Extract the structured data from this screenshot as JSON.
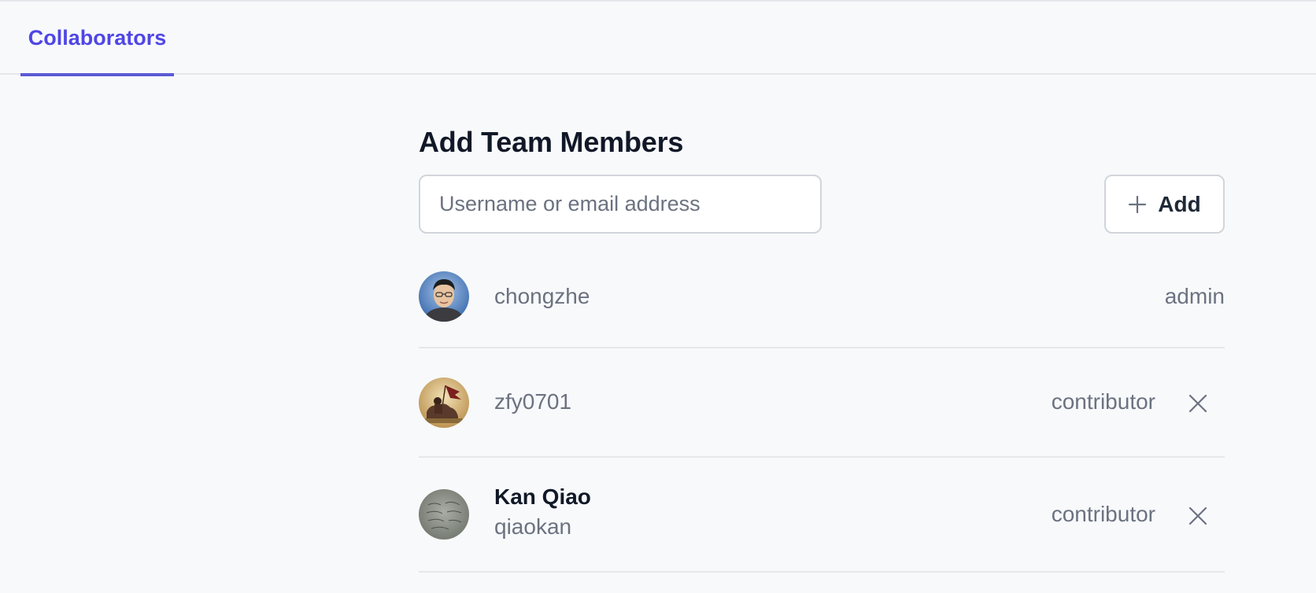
{
  "tabs": [
    {
      "label": "Collaborators",
      "active": true
    }
  ],
  "section": {
    "title": "Add Team Members"
  },
  "search": {
    "placeholder": "Username or email address",
    "value": ""
  },
  "add_button": {
    "label": "Add",
    "icon": "plus-icon"
  },
  "members": [
    {
      "name": "",
      "username": "chongzhe",
      "role": "admin",
      "removable": false,
      "avatar": "photo-avatar-icon"
    },
    {
      "name": "",
      "username": "zfy0701",
      "role": "contributor",
      "removable": true,
      "avatar": "photo-avatar-icon"
    },
    {
      "name": "Kan Qiao",
      "username": "qiaokan",
      "role": "contributor",
      "removable": true,
      "avatar": "photo-avatar-icon"
    }
  ],
  "colors": {
    "accent": "#4f46e5",
    "background": "#f8f9fb",
    "border": "#e5e7eb",
    "muted_text": "#6b7280"
  }
}
